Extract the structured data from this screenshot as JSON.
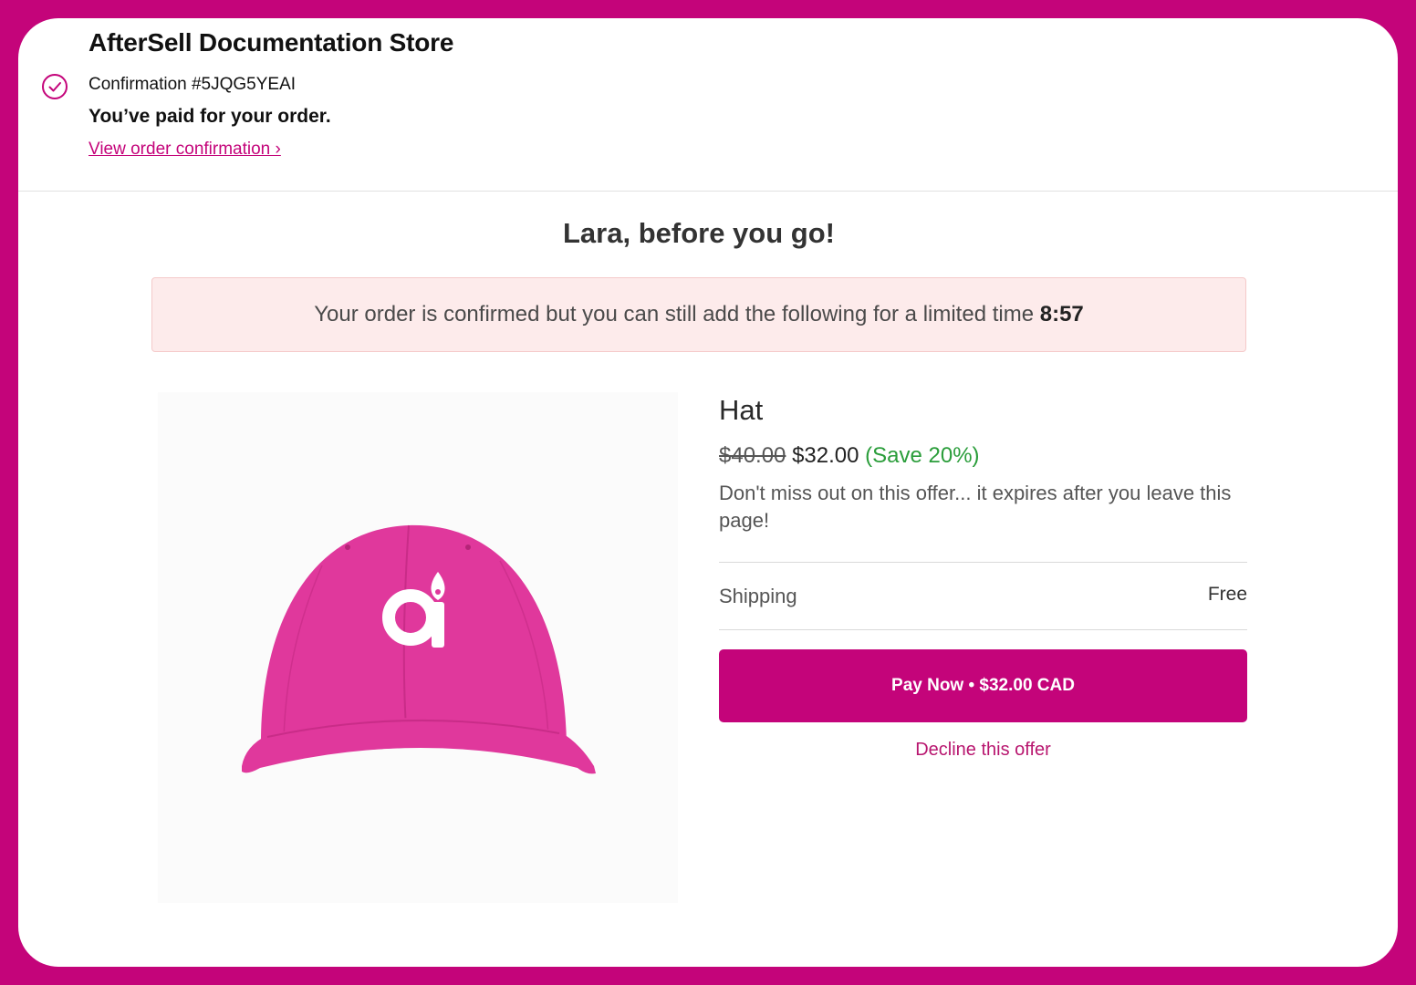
{
  "header": {
    "store_name": "AfterSell Documentation Store",
    "confirmation": "Confirmation #5JQG5YEAI",
    "paid_message": "You’ve paid for your order.",
    "view_link": "View order confirmation ›"
  },
  "offer": {
    "headline": "Lara, before you go!",
    "banner_text": "Your order is confirmed but you can still add the following for a limited time",
    "timer": "8:57"
  },
  "product": {
    "name": "Hat",
    "original_price": "$40.00",
    "sale_price": "$32.00",
    "save_text": "(Save 20%)",
    "description": "Don't miss out on this offer... it expires after you leave this page!",
    "shipping_label": "Shipping",
    "shipping_value": "Free",
    "image_icon": "pink-cap-with-logo"
  },
  "actions": {
    "pay_label": "Pay Now • $32.00 CAD",
    "decline_label": "Decline this offer"
  },
  "colors": {
    "brand": "#c4047a",
    "cap": "#e0389c",
    "save_green": "#2a9d3a",
    "banner_bg": "#fdebeb"
  }
}
